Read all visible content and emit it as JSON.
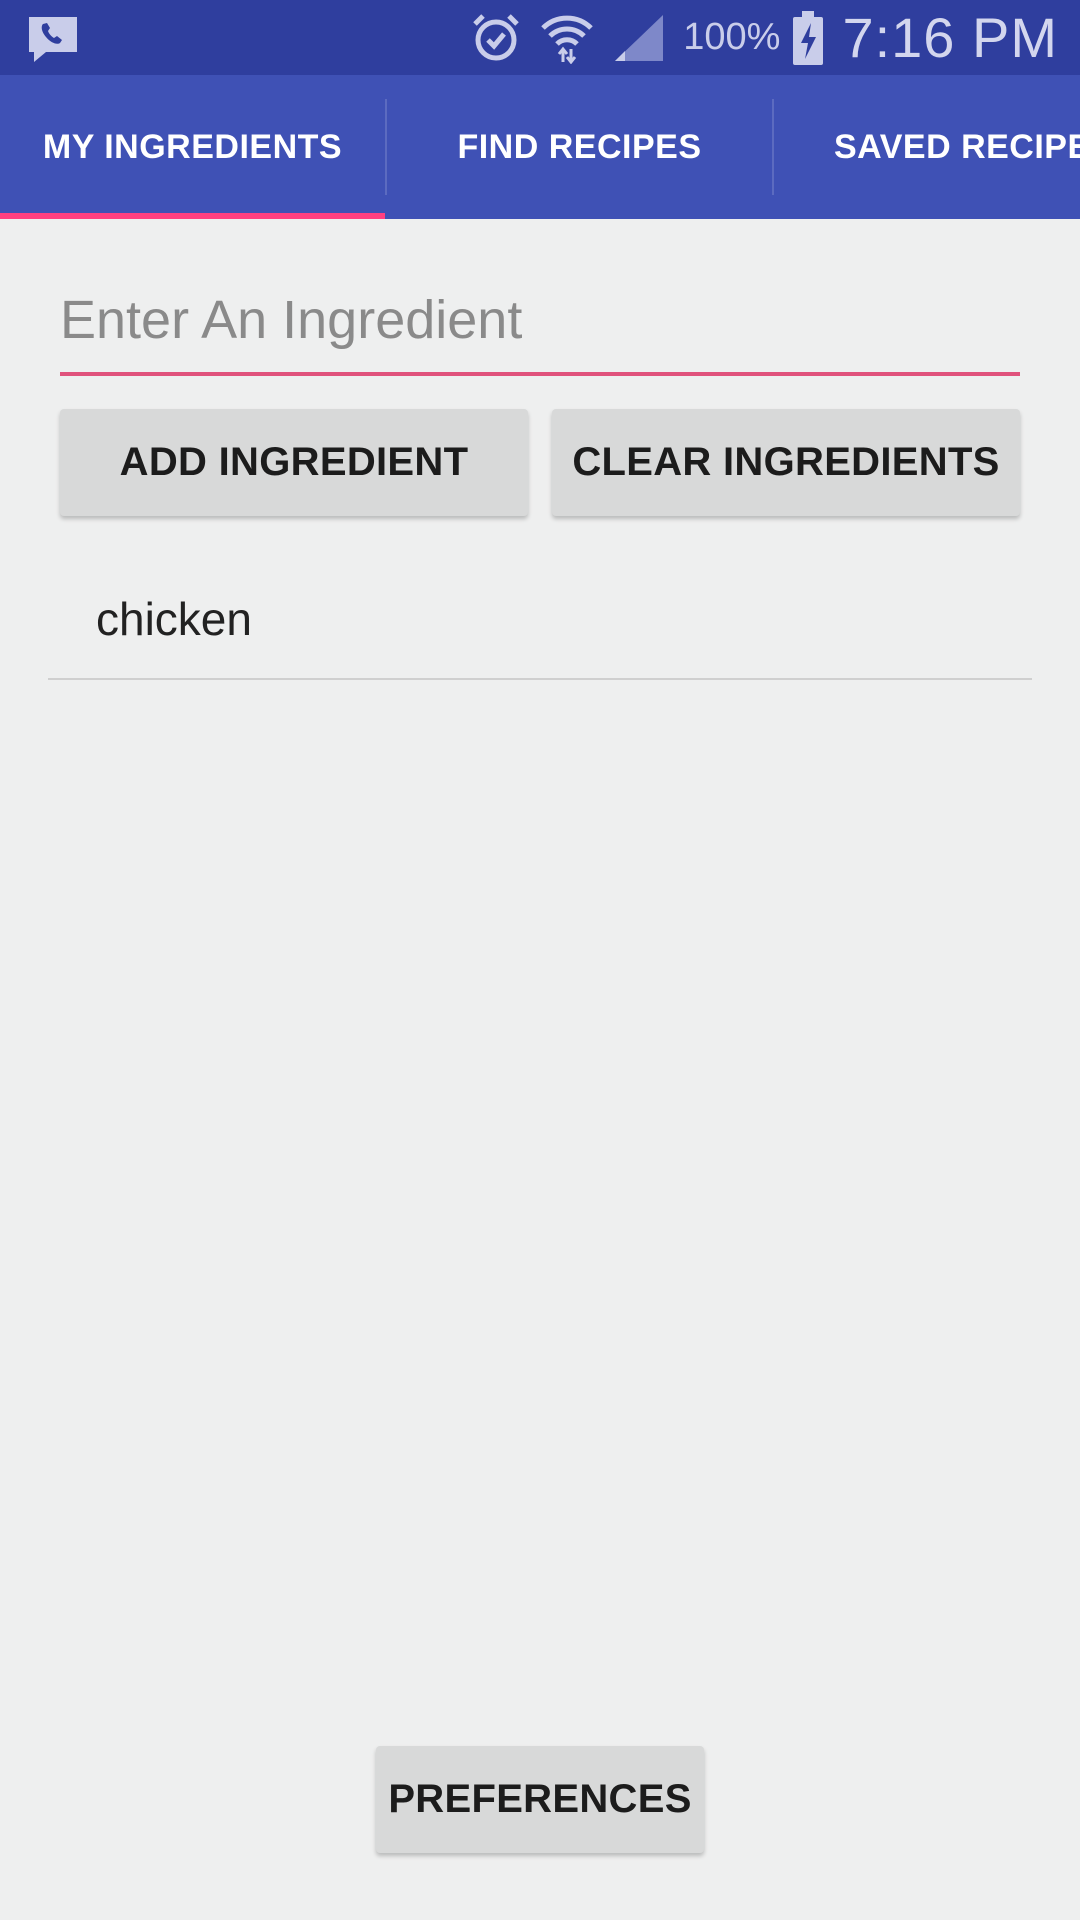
{
  "status_bar": {
    "battery_percent": "100%",
    "time": "7:16 PM",
    "icons": [
      "phone-chat-icon",
      "alarm-icon",
      "wifi-icon",
      "signal-icon",
      "battery-charging-icon"
    ]
  },
  "tabs": [
    {
      "label": "MY INGREDIENTS",
      "selected": true
    },
    {
      "label": "FIND RECIPES",
      "selected": false
    },
    {
      "label": "SAVED RECIPES",
      "selected": false
    }
  ],
  "input": {
    "placeholder": "Enter An Ingredient",
    "value": ""
  },
  "actions": {
    "add_label": "ADD INGREDIENT",
    "clear_label": "CLEAR INGREDIENTS"
  },
  "ingredients": [
    {
      "name": "chicken"
    }
  ],
  "footer": {
    "preferences_label": "PREFERENCES"
  },
  "colors": {
    "status_bar": "#2f3e9e",
    "tab_bar": "#3f51b5",
    "accent": "#ff4081",
    "background": "#eeefef",
    "button": "#d8d9d9"
  }
}
